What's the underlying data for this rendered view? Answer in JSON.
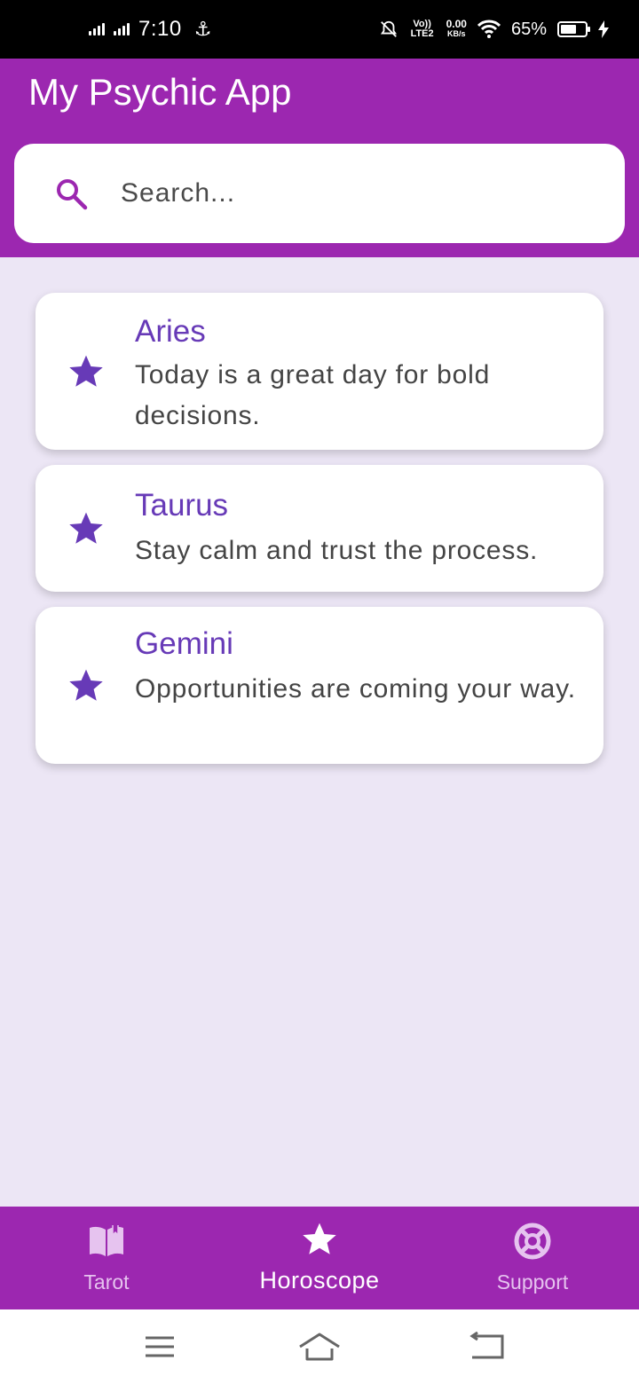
{
  "status_bar": {
    "time": "7:10",
    "volte": "Vo)) LTE2",
    "speed_value": "0.00",
    "speed_unit": "KB/s",
    "battery_percent": "65%",
    "battery_level": 0.65
  },
  "app_bar": {
    "title": "My Psychic App",
    "search_placeholder": "Search...",
    "search_value": ""
  },
  "horoscopes": [
    {
      "icon": "star-icon",
      "sign": "Aries",
      "text": "Today is a great day for bold decisions."
    },
    {
      "icon": "star-icon",
      "sign": "Taurus",
      "text": "Stay calm and trust the process."
    },
    {
      "icon": "star-icon",
      "sign": "Gemini",
      "text": "Opportunities are coming your way."
    }
  ],
  "bottom_nav": {
    "items": [
      {
        "label": "Tarot",
        "icon": "book-icon",
        "active": false
      },
      {
        "label": "Horoscope",
        "icon": "star-icon",
        "active": true
      },
      {
        "label": "Support",
        "icon": "lifebuoy-icon",
        "active": false
      }
    ]
  },
  "system_nav": {
    "buttons": [
      "menu-icon",
      "home-icon",
      "back-icon"
    ]
  },
  "colors": {
    "primary": "#9c27b0",
    "accent": "#673ab7",
    "background": "#ece6f5",
    "nav_inactive": "#e6c3ef"
  }
}
